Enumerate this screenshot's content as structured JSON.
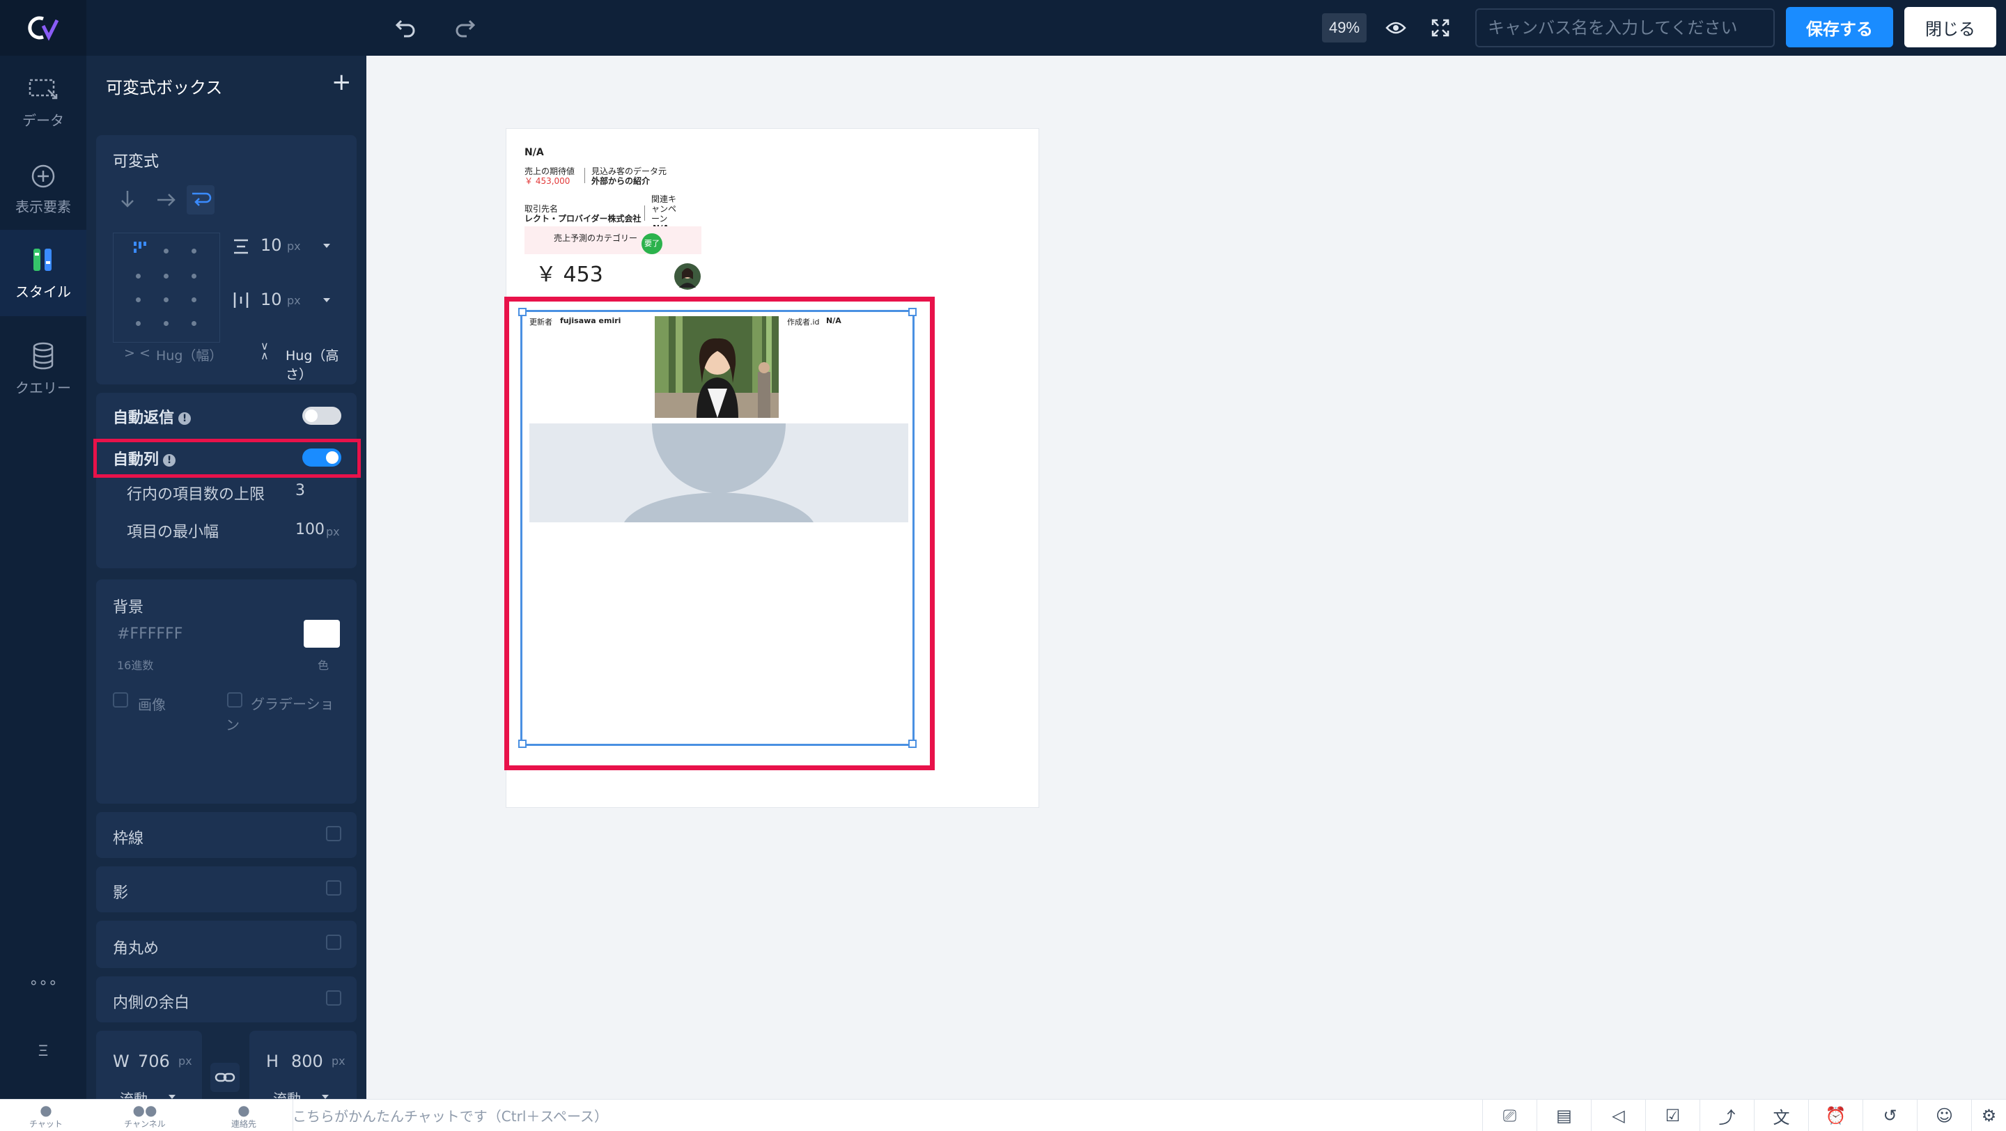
{
  "app": {
    "logo": "Cv"
  },
  "topbar": {
    "zoom": "49%",
    "canvas_name_placeholder": "キャンバス名を入力してください",
    "save_label": "保存する",
    "close_label": "閉じる"
  },
  "rail": {
    "items": [
      {
        "label": "データ",
        "icon": "data-icon"
      },
      {
        "label": "表示要素",
        "icon": "add-element-icon"
      },
      {
        "label": "スタイル",
        "icon": "style-icon"
      },
      {
        "label": "クエリー",
        "icon": "database-icon"
      }
    ],
    "more": "∘∘∘",
    "menu": "Ξ"
  },
  "panel": {
    "title": "可変式ボックス",
    "layout": {
      "section_label": "可変式",
      "gap_vertical": "10",
      "gap_horizontal": "10",
      "unit": "px",
      "width_mode": "Hug（幅）",
      "height_mode": "Hug（高さ）"
    },
    "auto_wrap": {
      "label": "自動返信",
      "on": false
    },
    "auto_columns": {
      "label": "自動列",
      "on": true,
      "max_items_label": "行内の項目数の上限",
      "max_items_value": "3",
      "min_width_label": "項目の最小幅",
      "min_width_value": "100",
      "min_width_unit": "px"
    },
    "background": {
      "label": "背景",
      "hex": "#FFFFFF",
      "hex_caption": "16進数",
      "color_caption": "色",
      "image_label": "画像",
      "gradient_label": "グラデーション"
    },
    "border_label": "枠線",
    "shadow_label": "影",
    "radius_label": "角丸め",
    "padding_label": "内側の余白",
    "size": {
      "w_label": "W",
      "w_value": "706",
      "h_label": "H",
      "h_value": "800",
      "unit": "px",
      "w_mode": "流動",
      "h_mode": "流動"
    }
  },
  "canvas": {
    "card": {
      "title": "N/A",
      "expected_sales_label": "売上の期待値",
      "expected_sales_value": "￥ 453,000",
      "lead_source_label": "見込み客のデータ元",
      "lead_source_value": "外部からの紹介",
      "client_label": "取引先名",
      "client_value": "レクト・プロバイダー株式会社",
      "campaign_label": "関連キャンペーン",
      "campaign_value": "N/A",
      "forecast_category_label": "売上予測のカテゴリー",
      "forecast_badge": "要了",
      "amount": "￥ 453"
    },
    "selected_box": {
      "updated_by_label": "更新者",
      "updated_by_value": "fujisawa emiri",
      "creator_id_label": "作成者.id",
      "creator_id_value": "N/A"
    }
  },
  "bottombar": {
    "tabs": [
      {
        "label": "チャット",
        "icon": "chat-icon"
      },
      {
        "label": "チャンネル",
        "icon": "channel-icon"
      },
      {
        "label": "連絡先",
        "icon": "contact-icon"
      }
    ],
    "chat_placeholder": "こちらがかんたんチャットです（Ctrl＋スペース）"
  },
  "colors": {
    "accent": "#1a8cff",
    "highlight": "#e8124a",
    "toggle_on": "#1a8cff",
    "selection": "#4a90e2"
  }
}
